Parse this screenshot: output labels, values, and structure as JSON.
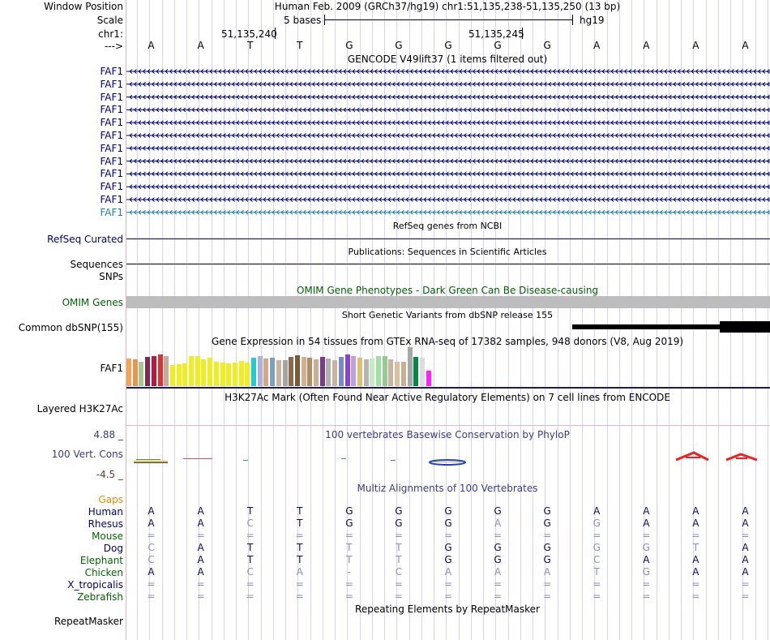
{
  "header": {
    "window_position_label": "Window Position",
    "window_position_value": "Human Feb. 2009 (GRCh37/hg19)   chr1:51,135,238-51,135,250 (13 bp)",
    "scale_label": "Scale",
    "scale_text": "5 bases",
    "scale_assembly": "hg19",
    "chrom_label": "chr1:",
    "coord1": "51,135,240",
    "coord2": "51,135,245",
    "strand_label": "--->"
  },
  "bases": [
    "A",
    "A",
    "T",
    "T",
    "G",
    "G",
    "G",
    "G",
    "G",
    "A",
    "A",
    "A",
    "A"
  ],
  "gencode": {
    "title": "GENCODE V49lift37 (1 items filtered out)",
    "labels": [
      "FAF1",
      "FAF1",
      "FAF1",
      "FAF1",
      "FAF1",
      "FAF1",
      "FAF1",
      "FAF1",
      "FAF1",
      "FAF1",
      "FAF1",
      "FAF1"
    ],
    "last_color": "#1a7fa6"
  },
  "refseq": {
    "title": "RefSeq genes from NCBI",
    "label": "RefSeq Curated"
  },
  "pubs": {
    "title": "Publications: Sequences in Scientific Articles",
    "label": "Sequences"
  },
  "snps_label": "SNPs",
  "omim": {
    "title": "OMIM Gene Phenotypes - Dark Green Can Be Disease-causing",
    "label": "OMIM Genes"
  },
  "dbsnp": {
    "title": "Short Genetic Variants from dbSNP release 155",
    "label": "Common dbSNP(155)"
  },
  "gtex": {
    "title": "Gene Expression in 54 tissues from GTEx RNA-seq of 17382 samples, 948 donors (V8, Aug 2019)",
    "label": "FAF1",
    "bars": [
      {
        "v": 0.7,
        "c": "#f2a65a"
      },
      {
        "v": 0.68,
        "c": "#e69552"
      },
      {
        "v": 0.62,
        "c": "#a8c68f"
      },
      {
        "v": 0.75,
        "c": "#7c2a4e"
      },
      {
        "v": 0.78,
        "c": "#b8183e"
      },
      {
        "v": 0.82,
        "c": "#e03030"
      },
      {
        "v": 0.78,
        "c": "#c9a89e"
      },
      {
        "v": 0.55,
        "c": "#eeee22"
      },
      {
        "v": 0.57,
        "c": "#eeee22"
      },
      {
        "v": 0.58,
        "c": "#eeee22"
      },
      {
        "v": 0.78,
        "c": "#eeee22"
      },
      {
        "v": 0.78,
        "c": "#eeee22"
      },
      {
        "v": 0.68,
        "c": "#eeee22"
      },
      {
        "v": 0.72,
        "c": "#eeee22"
      },
      {
        "v": 0.62,
        "c": "#eeee22"
      },
      {
        "v": 0.6,
        "c": "#eeee22"
      },
      {
        "v": 0.58,
        "c": "#eeee22"
      },
      {
        "v": 0.6,
        "c": "#eeee22"
      },
      {
        "v": 0.65,
        "c": "#eeee22"
      },
      {
        "v": 0.6,
        "c": "#eeee22"
      },
      {
        "v": 0.72,
        "c": "#22cccc"
      },
      {
        "v": 0.78,
        "c": "#b0b0e0"
      },
      {
        "v": 0.7,
        "c": "#d2a87c"
      },
      {
        "v": 0.72,
        "c": "#7aa0c8"
      },
      {
        "v": 0.66,
        "c": "#c8b4a0"
      },
      {
        "v": 0.66,
        "c": "#a4a4a4"
      },
      {
        "v": 0.74,
        "c": "#8a6a4a"
      },
      {
        "v": 0.8,
        "c": "#7a5a3a"
      },
      {
        "v": 0.76,
        "c": "#d0b090"
      },
      {
        "v": 0.72,
        "c": "#b48c64"
      },
      {
        "v": 0.68,
        "c": "#c8b090"
      },
      {
        "v": 0.75,
        "c": "#7a3a8a"
      },
      {
        "v": 0.7,
        "c": "#b0b0b0"
      },
      {
        "v": 0.66,
        "c": "#c8b4a0"
      },
      {
        "v": 0.74,
        "c": "#7a8ac8"
      },
      {
        "v": 0.82,
        "c": "#8844cc"
      },
      {
        "v": 0.78,
        "c": "#c0a0e0"
      },
      {
        "v": 0.72,
        "c": "#e0c070"
      },
      {
        "v": 0.68,
        "c": "#b4b4b4"
      },
      {
        "v": 0.7,
        "c": "#c8e8c8"
      },
      {
        "v": 0.78,
        "c": "#a0e0a0"
      },
      {
        "v": 0.78,
        "c": "#98c898"
      },
      {
        "v": 0.68,
        "c": "#c8b4a0"
      },
      {
        "v": 0.62,
        "c": "#d8c0a0"
      },
      {
        "v": 0.62,
        "c": "#c8b090"
      },
      {
        "v": 1.0,
        "c": "#a8a8a8"
      },
      {
        "v": 0.75,
        "c": "#008844"
      },
      {
        "v": 0.72,
        "c": "#dddddd"
      },
      {
        "v": 0.4,
        "c": "#ff22ff"
      }
    ]
  },
  "h3k27": {
    "title": "H3K27Ac Mark (Often Found Near Active Regulatory Elements) on 7 cell lines from ENCODE",
    "label": "Layered H3K27Ac"
  },
  "phylop": {
    "title": "100 vertebrates Basewise Conservation by PhyloP",
    "label": "100 Vert. Cons",
    "max": "4.88 _",
    "min": "-4.5 _"
  },
  "multiz": {
    "title": "Multiz Alignments of 100 Vertebrates",
    "gaps_label": "Gaps",
    "species": [
      {
        "name": "Human",
        "color": "#000080",
        "seq": [
          "A",
          "A",
          "T",
          "T",
          "G",
          "G",
          "G",
          "G",
          "G",
          "A",
          "A",
          "A",
          "A"
        ],
        "dim": [
          0,
          0,
          0,
          0,
          0,
          0,
          0,
          0,
          0,
          0,
          0,
          0,
          0
        ]
      },
      {
        "name": "Rhesus",
        "color": "#000080",
        "seq": [
          "A",
          "A",
          "C",
          "T",
          "G",
          "G",
          "G",
          "A",
          "G",
          "G",
          "A",
          "A",
          "A"
        ],
        "dim": [
          0,
          0,
          1,
          0,
          0,
          0,
          0,
          1,
          0,
          1,
          0,
          0,
          0
        ]
      },
      {
        "name": "Mouse",
        "color": "#006400",
        "seq": [
          "=",
          "=",
          "=",
          "=",
          "=",
          "=",
          "=",
          "=",
          "=",
          "=",
          "=",
          "=",
          "="
        ],
        "dim": [
          1,
          1,
          1,
          1,
          1,
          1,
          1,
          1,
          1,
          1,
          1,
          1,
          1
        ]
      },
      {
        "name": "Dog",
        "color": "#000080",
        "seq": [
          "C",
          "A",
          "T",
          "T",
          "T",
          "T",
          "G",
          "G",
          "G",
          "G",
          "G",
          "T",
          "A"
        ],
        "dim": [
          1,
          0,
          0,
          0,
          1,
          1,
          0,
          0,
          0,
          1,
          1,
          1,
          0
        ]
      },
      {
        "name": "Elephant",
        "color": "#006400",
        "seq": [
          "C",
          "A",
          "T",
          "T",
          "T",
          "T",
          "G",
          "G",
          "G",
          "C",
          "A",
          "A",
          "A"
        ],
        "dim": [
          1,
          0,
          0,
          0,
          1,
          1,
          0,
          0,
          0,
          1,
          0,
          0,
          0
        ]
      },
      {
        "name": "Chicken",
        "color": "#006400",
        "seq": [
          "A",
          "A",
          "C",
          "A",
          "-",
          "C",
          "A",
          "A",
          "A",
          "T",
          "G",
          "A",
          "A"
        ],
        "dim": [
          0,
          0,
          1,
          1,
          1,
          1,
          1,
          1,
          1,
          1,
          1,
          0,
          0
        ]
      },
      {
        "name": "X_tropicalis",
        "color": "#000080",
        "seq": [
          "=",
          "=",
          "=",
          "=",
          "=",
          "=",
          "=",
          "=",
          "=",
          "=",
          "=",
          "=",
          "="
        ],
        "dim": [
          1,
          1,
          1,
          1,
          1,
          1,
          1,
          1,
          1,
          1,
          1,
          1,
          1
        ]
      },
      {
        "name": "Zebrafish",
        "color": "#006400",
        "seq": [
          "=",
          "=",
          "=",
          "=",
          "=",
          "=",
          "=",
          "=",
          "=",
          "=",
          "=",
          "=",
          "="
        ],
        "dim": [
          1,
          1,
          1,
          1,
          1,
          1,
          1,
          1,
          1,
          1,
          1,
          1,
          1
        ]
      }
    ]
  },
  "repeatmasker": {
    "title": "Repeating Elements by RepeatMasker",
    "label": "RepeatMasker"
  }
}
